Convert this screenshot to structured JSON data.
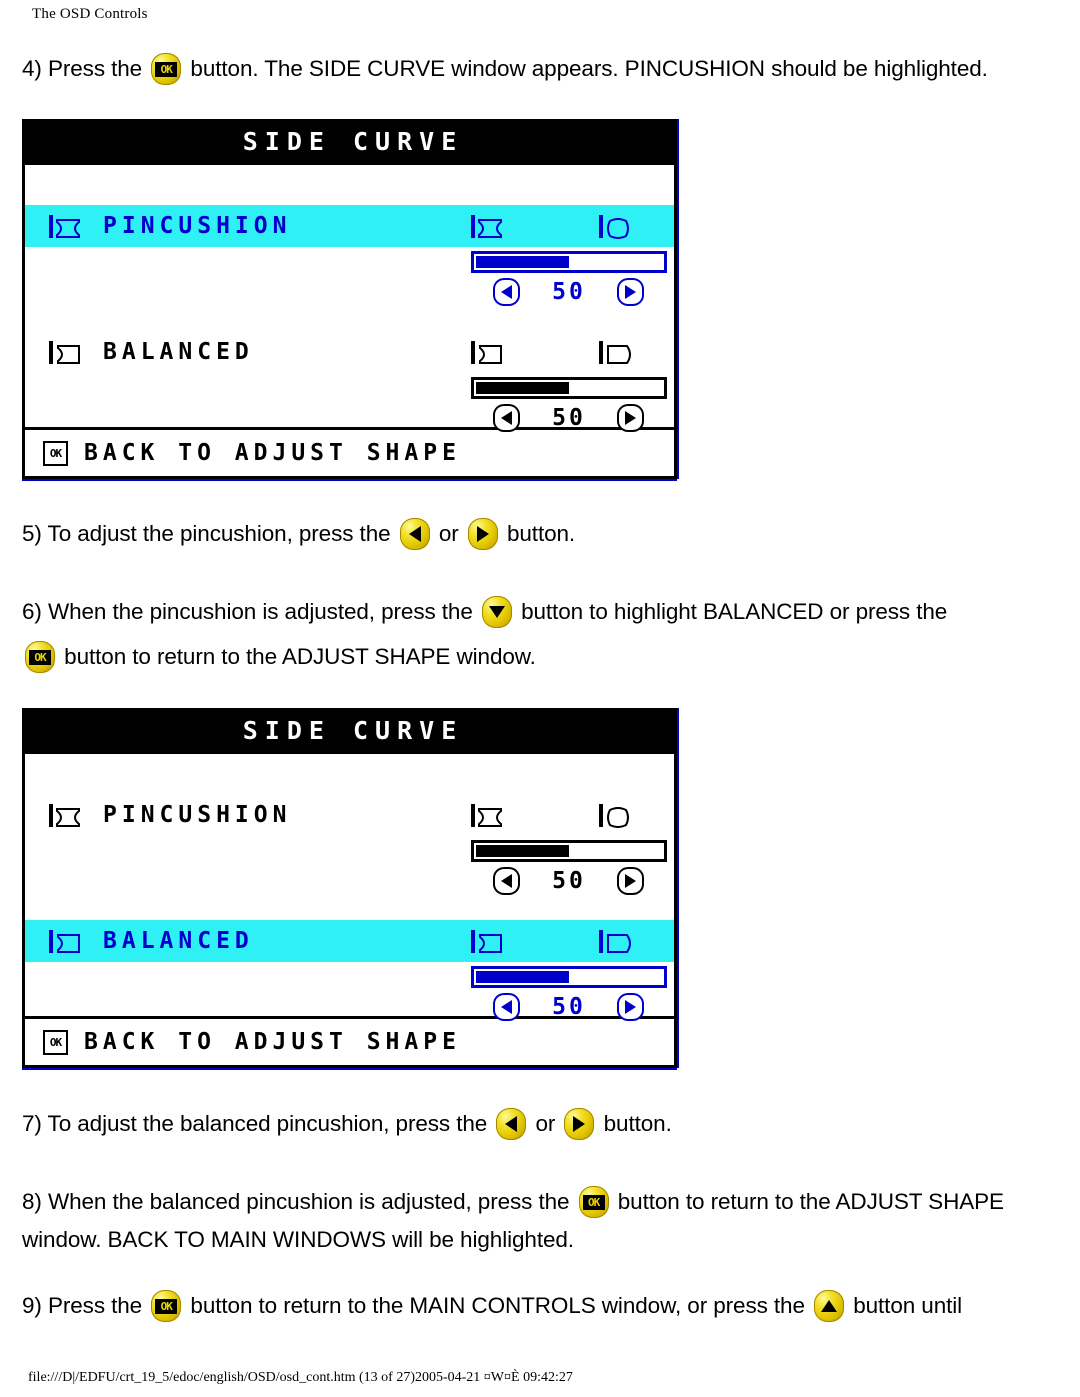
{
  "page": {
    "header": "The OSD Controls",
    "filepath": "file:///D|/EDFU/crt_19_5/edoc/english/OSD/osd_cont.htm (13 of 27)2005-04-21 ¤W¤È 09:42:27"
  },
  "colors": {
    "highlight": "#2FF0F4",
    "osd_blue": "#0000CC",
    "osd_black": "#000000",
    "button_yellow": "#E3C800"
  },
  "icons": {
    "ok": "ok-button-icon",
    "left": "left-arrow-button-icon",
    "right": "right-arrow-button-icon",
    "up": "up-arrow-button-icon",
    "down": "down-arrow-button-icon"
  },
  "steps": {
    "s4": {
      "a": "4) Press the",
      "b": "button. The SIDE CURVE window appears. PINCUSHION should be highlighted."
    },
    "s5": {
      "a": "5) To adjust the pincushion, press the",
      "b": "or",
      "c": "button."
    },
    "s6": {
      "a": "6) When the pincushion is adjusted, press the",
      "b": "button to highlight BALANCED or press the",
      "c": "button to return to the ADJUST SHAPE window."
    },
    "s7": {
      "a": "7) To adjust the balanced pincushion, press the",
      "b": "or",
      "c": "button."
    },
    "s8": {
      "a": "8) When the balanced pincushion is adjusted, press the",
      "b": "button to return to the ADJUST SHAPE",
      "c": "window. BACK TO MAIN WINDOWS will be highlighted."
    },
    "s9": {
      "a": "9) Press the",
      "b": "button to return to the MAIN CONTROLS window, or press the",
      "c": "button until"
    }
  },
  "osd1": {
    "title": "SIDE CURVE",
    "footer_label": "BACK TO ADJUST SHAPE",
    "footer_icon": "OK",
    "rows": [
      {
        "label": "PINCUSHION",
        "highlighted": true,
        "left_icon": "pincushion-shape-icon",
        "icon_a": "pincushion-concave-icon",
        "icon_b": "pincushion-convex-icon",
        "value": "50",
        "fill_percent": 50
      },
      {
        "label": "BALANCED",
        "highlighted": false,
        "left_icon": "balanced-shape-icon",
        "icon_a": "balanced-left-icon",
        "icon_b": "balanced-right-icon",
        "value": "50",
        "fill_percent": 50
      }
    ]
  },
  "osd2": {
    "title": "SIDE CURVE",
    "footer_label": "BACK TO ADJUST SHAPE",
    "footer_icon": "OK",
    "rows": [
      {
        "label": "PINCUSHION",
        "highlighted": false,
        "left_icon": "pincushion-shape-icon",
        "icon_a": "pincushion-concave-icon",
        "icon_b": "pincushion-convex-icon",
        "value": "50",
        "fill_percent": 50
      },
      {
        "label": "BALANCED",
        "highlighted": true,
        "left_icon": "balanced-shape-icon",
        "icon_a": "balanced-left-icon",
        "icon_b": "balanced-right-icon",
        "value": "50",
        "fill_percent": 50
      }
    ]
  }
}
